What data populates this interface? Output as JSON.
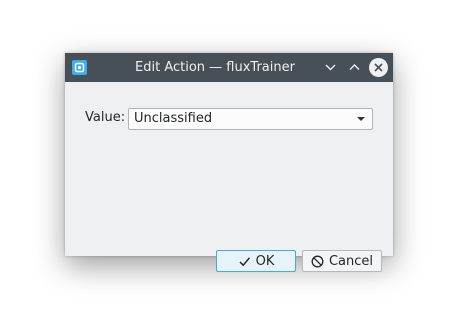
{
  "window": {
    "title": "Edit Action — fluxTrainer"
  },
  "form": {
    "value_label": "Value:",
    "value_selected": "Unclassified"
  },
  "buttons": {
    "ok_label": "OK",
    "cancel_label": "Cancel"
  },
  "icons": {
    "app": "app-icon",
    "minimize": "chevron-down-icon",
    "maximize": "chevron-up-icon",
    "close": "close-icon",
    "ok": "checkmark-icon",
    "cancel": "cancel-circle-icon"
  },
  "colors": {
    "titlebar": "#475057",
    "window_bg": "#eff0f1",
    "accent": "#3daee9"
  }
}
